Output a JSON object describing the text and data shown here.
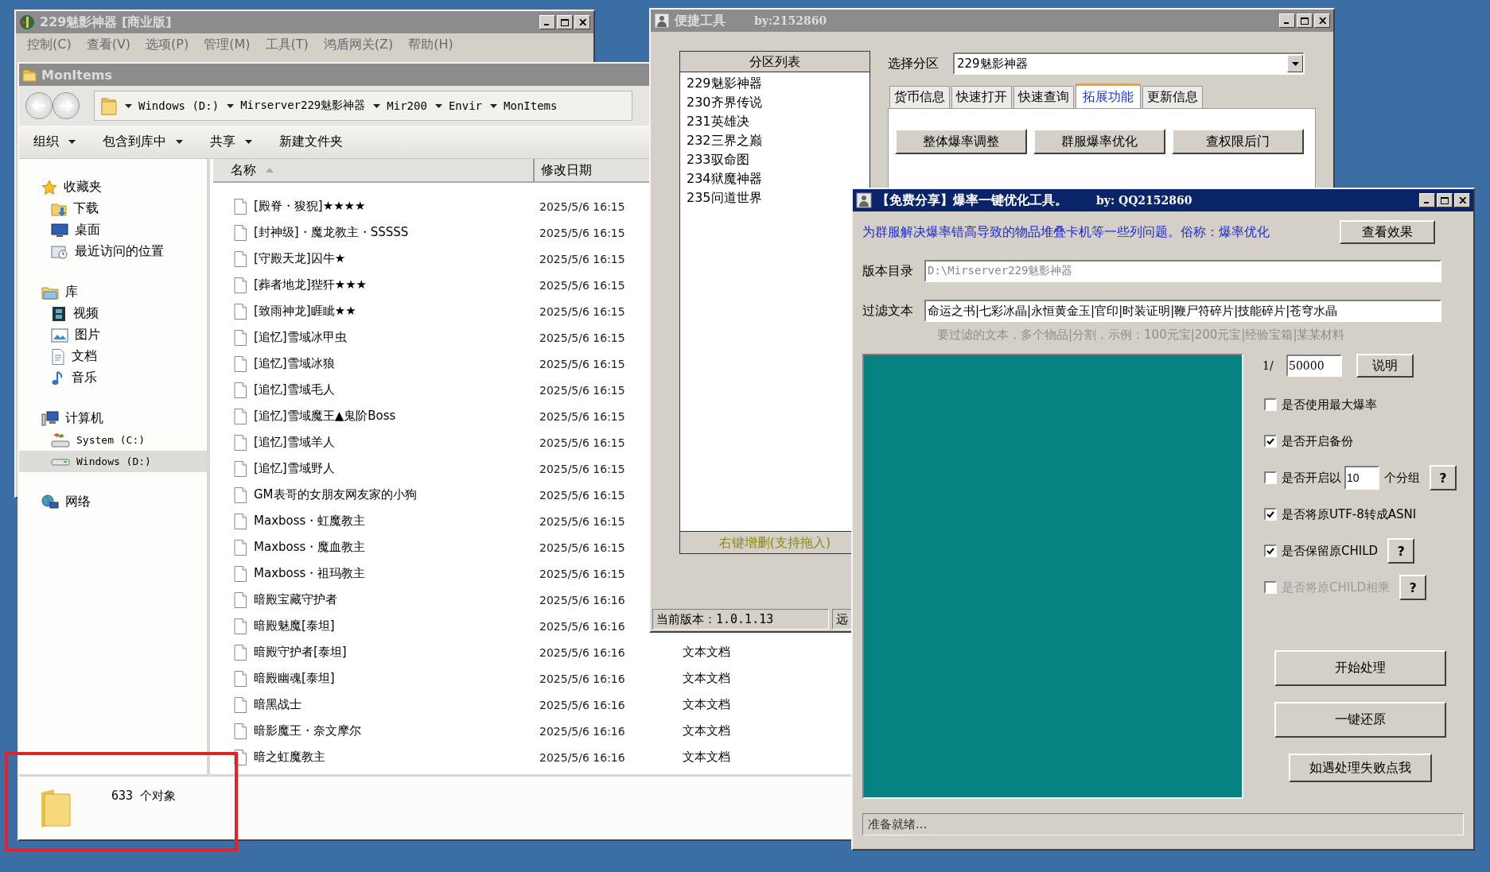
{
  "main_window": {
    "title": "229魅影神器 [商业版]",
    "active": false,
    "menu": [
      "控制(C)",
      "查看(V)",
      "选项(P)",
      "管理(M)",
      "工具(T)",
      "鸿盾网关(Z)",
      "帮助(H)"
    ]
  },
  "explorer": {
    "title": "MonItems",
    "active": false,
    "breadcrumb": [
      "Windows (D:)",
      "Mirserver229魅影神器",
      "Mir200",
      "Envir",
      "MonItems"
    ],
    "toolbar": [
      {
        "label": "组织",
        "dropdown": true
      },
      {
        "label": "包含到库中",
        "dropdown": true
      },
      {
        "label": "共享",
        "dropdown": true
      },
      {
        "label": "新建文件夹",
        "dropdown": false
      }
    ],
    "nav": [
      {
        "label": "收藏夹",
        "selected": false,
        "children": [
          {
            "label": "下载",
            "selected": false
          },
          {
            "label": "桌面",
            "selected": false
          },
          {
            "label": "最近访问的位置",
            "selected": false
          }
        ]
      },
      {
        "label": "库",
        "selected": false,
        "children": [
          {
            "label": "视频",
            "selected": false
          },
          {
            "label": "图片",
            "selected": false
          },
          {
            "label": "文档",
            "selected": false
          },
          {
            "label": "音乐",
            "selected": false
          }
        ]
      },
      {
        "label": "计算机",
        "selected": false,
        "children": [
          {
            "label": "System (C:)",
            "selected": false
          },
          {
            "label": "Windows (D:)",
            "selected": true
          }
        ]
      },
      {
        "label": "网络",
        "selected": false
      }
    ],
    "columns": [
      "名称",
      "修改日期"
    ],
    "files": [
      {
        "name": "[殿脊・狻猊]★★★★",
        "modified": "2025/5/6 16:15"
      },
      {
        "name": "[封神级]・魔龙教主・SSSSS",
        "modified": "2025/5/6 16:15"
      },
      {
        "name": "[守殿天龙]囚牛★",
        "modified": "2025/5/6 16:15"
      },
      {
        "name": "[葬者地龙]狴犴★★★",
        "modified": "2025/5/6 16:15"
      },
      {
        "name": "[致雨神龙]睚眦★★",
        "modified": "2025/5/6 16:15"
      },
      {
        "name": "[追忆]雪域冰甲虫",
        "modified": "2025/5/6 16:15"
      },
      {
        "name": "[追忆]雪域冰狼",
        "modified": "2025/5/6 16:15"
      },
      {
        "name": "[追忆]雪域毛人",
        "modified": "2025/5/6 16:15"
      },
      {
        "name": "[追忆]雪域魔王▲鬼阶Boss",
        "modified": "2025/5/6 16:15"
      },
      {
        "name": "[追忆]雪域羊人",
        "modified": "2025/5/6 16:15"
      },
      {
        "name": "[追忆]雪域野人",
        "modified": "2025/5/6 16:15"
      },
      {
        "name": "GM表哥的女朋友网友家的小狗",
        "modified": "2025/5/6 16:15"
      },
      {
        "name": "Maxboss・虹魔教主",
        "modified": "2025/5/6 16:15"
      },
      {
        "name": "Maxboss・魔血教主",
        "modified": "2025/5/6 16:15"
      },
      {
        "name": "Maxboss・祖玛教主",
        "modified": "2025/5/6 16:15"
      },
      {
        "name": "暗殿宝藏守护者",
        "modified": "2025/5/6 16:16"
      },
      {
        "name": "暗殿魅魔[泰坦]",
        "modified": "2025/5/6 16:16"
      },
      {
        "name": "暗殿守护者[泰坦]",
        "modified": "2025/5/6 16:16",
        "type": "文本文档"
      },
      {
        "name": "暗殿幽魂[泰坦]",
        "modified": "2025/5/6 16:16",
        "type": "文本文档"
      },
      {
        "name": "暗黑战士",
        "modified": "2025/5/6 16:16",
        "type": "文本文档"
      },
      {
        "name": "暗影魔王・奈文摩尔",
        "modified": "2025/5/6 16:16",
        "type": "文本文档"
      },
      {
        "name": "暗之虹魔教主",
        "modified": "2025/5/6 16:16",
        "type": "文本文档"
      }
    ],
    "status": "633 个对象"
  },
  "quick_tool": {
    "title": "便捷工具",
    "author": "by:2152860",
    "active": false,
    "partition_list": {
      "header": "分区列表",
      "items": [
        {
          "label": "229魅影神器",
          "selected": false
        },
        {
          "label": "230齐界传说",
          "selected": false
        },
        {
          "label": "231英雄决",
          "selected": false
        },
        {
          "label": "232三界之巅",
          "selected": false
        },
        {
          "label": "233驭命图",
          "selected": false
        },
        {
          "label": "234狱魔神器",
          "selected": false
        },
        {
          "label": "235问道世界",
          "selected": false
        }
      ],
      "footer": "右键增删(支持拖入)"
    },
    "select_label": "选择分区",
    "select_value": "229魅影神器",
    "tabs": [
      {
        "label": "货币信息",
        "selected": false
      },
      {
        "label": "快速打开",
        "selected": false
      },
      {
        "label": "快速查询",
        "selected": false
      },
      {
        "label": "拓展功能",
        "selected": true
      },
      {
        "label": "更新信息",
        "selected": false
      }
    ],
    "buttons": [
      "整体爆率调整",
      "群服爆率优化",
      "查权限后门"
    ],
    "status": [
      "当前版本：1.0.1.13",
      "远"
    ]
  },
  "optimizer": {
    "title": "【免费分享】爆率一键优化工具。",
    "author": "by: QQ2152860",
    "active": true,
    "description": "为群服解决爆率错高导致的物品堆叠卡机等一些列问题。俗称：爆率优化",
    "view_button": "查看效果",
    "fields": [
      {
        "label": "版本目录",
        "value": "D:\\Mirserver229魅影神器",
        "disabled": true
      },
      {
        "label": "过滤文本",
        "value": "命运之书|七彩冰晶|永恒黄金玉|官印|时装证明|鞭尸符碎片|技能碎片|苍穹水晶",
        "disabled": false
      }
    ],
    "hint": "要过滤的文本，多个物品|分割，示例：100元宝|200元宝|经验宝箱|某某材料",
    "ratio_label": "1/",
    "ratio_value": "50000",
    "explain_button": "说明",
    "options": [
      {
        "kind": "checkbox",
        "label": "是否使用最大爆率",
        "checked": false,
        "disabled": false
      },
      {
        "kind": "checkbox",
        "label": "是否开启备份",
        "checked": true,
        "disabled": false
      },
      {
        "kind": "checkbox-count",
        "label": "是否开启以",
        "value": "10",
        "suffix": "个分组",
        "help": "?",
        "checked": false,
        "disabled": false
      },
      {
        "kind": "checkbox",
        "label": "是否将原UTF-8转成ASNI",
        "checked": true,
        "disabled": false
      },
      {
        "kind": "checkbox-help",
        "label": "是否保留原CHILD",
        "help": "?",
        "checked": true,
        "disabled": false
      },
      {
        "kind": "checkbox-help",
        "label": "是否将原CHILD相乘",
        "help": "?",
        "checked": false,
        "disabled": true
      }
    ],
    "actions": [
      {
        "label": "开始处理",
        "kind": "wide"
      },
      {
        "label": "一键还原",
        "kind": "wide"
      },
      {
        "label": "如遇处理失败点我",
        "kind": "narrow"
      }
    ],
    "status": "准备就绪..."
  }
}
